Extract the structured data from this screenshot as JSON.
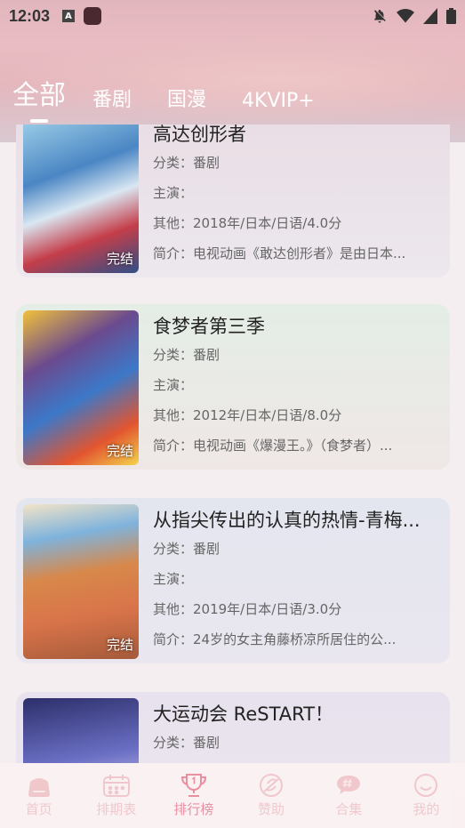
{
  "status": {
    "time": "12:03",
    "a_icon": "A"
  },
  "tabs": [
    {
      "label": "全部",
      "active": true
    },
    {
      "label": "番剧",
      "active": false
    },
    {
      "label": "国漫",
      "active": false
    },
    {
      "label": "4KVIP+",
      "active": false
    }
  ],
  "items": [
    {
      "title": "高达创形者",
      "category": "分类：番剧",
      "cast": "主演：",
      "other": "其他：2018年/日本/日语/4.0分",
      "intro": "简介：电视动画《敢达创形者》是由日本...",
      "badge": "完结"
    },
    {
      "title": "食梦者第三季",
      "category": "分类：番剧",
      "cast": "主演：",
      "other": "其他：2012年/日本/日语/8.0分",
      "intro": "简介：电视动画《爆漫王。》（食梦者）...",
      "badge": "完结"
    },
    {
      "title": "从指尖传出的认真的热情-青梅...",
      "category": "分类：番剧",
      "cast": "主演：",
      "other": "其他：2019年/日本/日语/3.0分",
      "intro": "简介：24岁的女主角藤桥凉所居住的公...",
      "badge": "完结"
    },
    {
      "title": "大运动会 ReSTART！",
      "category": "分类：番剧"
    }
  ],
  "nav": [
    {
      "label": "首页",
      "icon": "home-icon"
    },
    {
      "label": "排期表",
      "icon": "calendar-icon"
    },
    {
      "label": "排行榜",
      "icon": "trophy-icon",
      "active": true
    },
    {
      "label": "赞助",
      "icon": "sponsor-icon"
    },
    {
      "label": "合集",
      "icon": "collection-icon"
    },
    {
      "label": "我的",
      "icon": "profile-icon"
    }
  ],
  "colors": {
    "accent": "#ea8fa0",
    "inactive": "#f0c8cc"
  }
}
